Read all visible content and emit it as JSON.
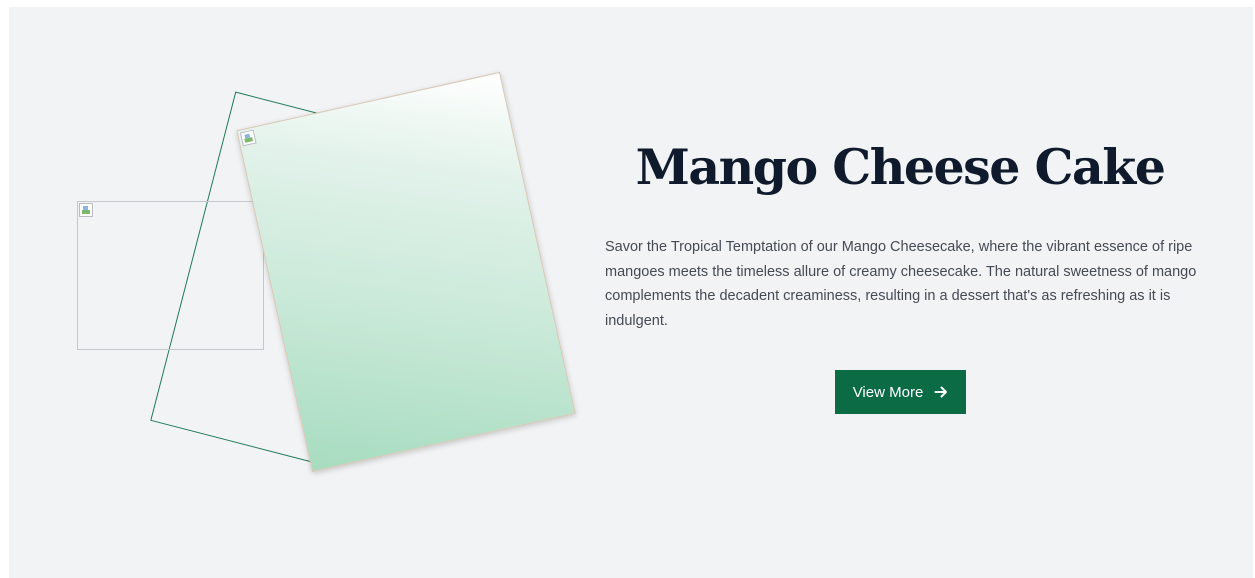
{
  "product": {
    "title": "Mango Cheese Cake",
    "description": "Savor the Tropical Temptation of our Mango Cheesecake, where the vibrant essence of ripe mangoes meets the timeless allure of creamy cheesecake. The natural sweetness of mango complements the decadent creaminess, resulting in a dessert that's as refreshing as it is indulgent.",
    "cta": {
      "label": "View More",
      "icon": "arrow-right-icon"
    }
  },
  "colors": {
    "background": "#f2f3f5",
    "title": "#0f1a2c",
    "text": "#444b55",
    "accent": "#0b6b45",
    "frame": "#1f7a55"
  }
}
